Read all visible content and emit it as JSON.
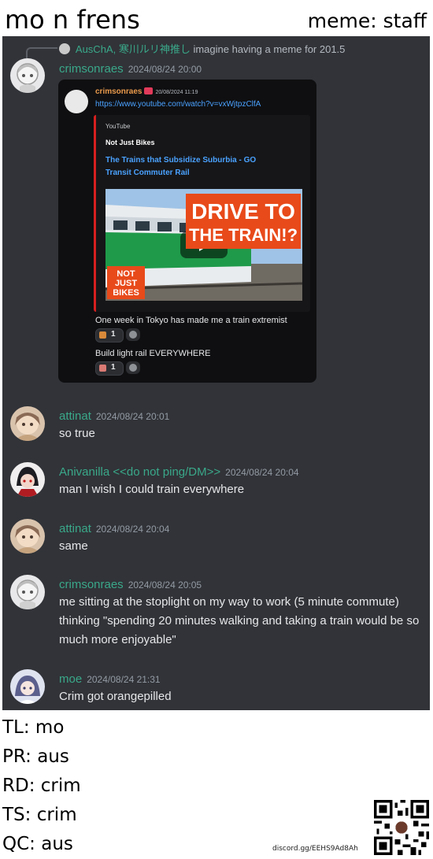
{
  "header": {
    "title": "mo n frens",
    "meme_label": "meme: staff"
  },
  "reply": {
    "name": "AusChA, 寒川ルリ神推し",
    "text": "imagine having a meme for 201.5"
  },
  "messages": [
    {
      "name": "crimsonraes",
      "time": "2024/08/24 20:00"
    },
    {
      "name": "attinat",
      "time": "2024/08/24 20:01",
      "text": "so true"
    },
    {
      "name": "Anivanilla <<do not ping/DM>>",
      "time": "2024/08/24 20:04",
      "text": "man I wish I could train everywhere"
    },
    {
      "name": "attinat",
      "time": "2024/08/24 20:04",
      "text": "same"
    },
    {
      "name": "crimsonraes",
      "time": "2024/08/24 20:05",
      "text": "me sitting at the stoplight on my way to work (5 minute commute) thinking \"spending 20 minutes walking and taking a train would be so much more enjoyable\""
    },
    {
      "name": "moe",
      "time": "2024/08/24 21:31",
      "text": "Crim got orangepilled"
    }
  ],
  "embed": {
    "name": "crimsonraes",
    "time": "20/08/2024 11:19",
    "link": "https://www.youtube.com/watch?v=vxWjtpzClfA",
    "provider": "YouTube",
    "author": "Not Just Bikes",
    "video_title": "The Trains that Subsidize Suburbia - GO Transit Commuter Rail",
    "thumb_headline_1": "DRIVE TO",
    "thumb_headline_2": "THE TRAIN!?",
    "thumb_logo_1": "NOT",
    "thumb_logo_2": "JUST",
    "thumb_logo_3": "BIKES",
    "line1": "One week in Tokyo has made me a train extremist",
    "line2": "Build light rail EVERYWHERE",
    "reaction1_count": "1",
    "reaction2_count": "1"
  },
  "credits": [
    "TL: mo",
    "PR: aus",
    "RD: crim",
    "TS: crim",
    "QC: aus"
  ],
  "invite": "discord.gg/EEHS9Ad8Ah",
  "colors": {
    "background": "#313338",
    "username": "#3aa88a",
    "link": "#4aa2ff",
    "embed_bar": "#d61f1f"
  }
}
